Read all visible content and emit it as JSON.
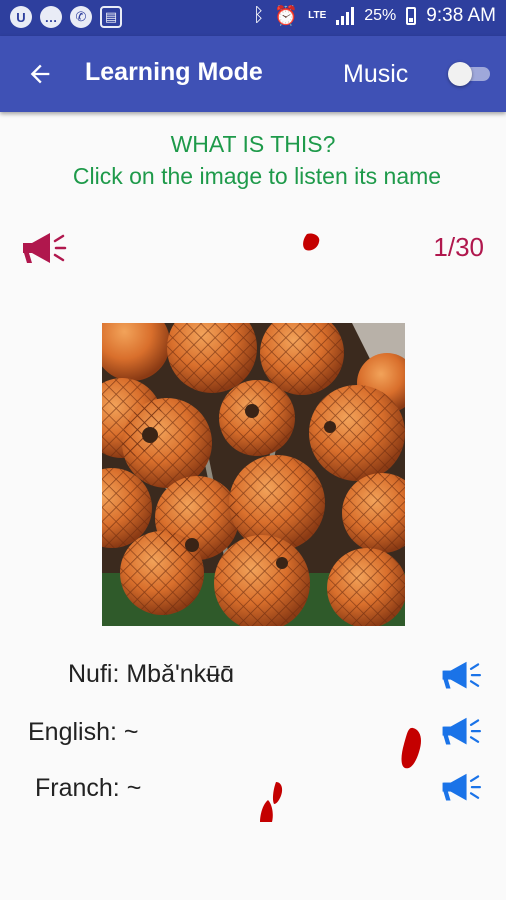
{
  "status_bar": {
    "notifications": [
      "U",
      "…",
      "✆",
      "▤"
    ],
    "network": "LTE",
    "battery": "25%",
    "time": "9:38 AM"
  },
  "app_bar": {
    "title": "Learning Mode",
    "music_label": "Music",
    "music_on": false,
    "colors": {
      "primary": "#3f51b5",
      "status": "#2e3f9e"
    }
  },
  "quiz": {
    "question": "WHAT IS THIS?",
    "instruction": "Click on the image to listen its name",
    "counter": "1/30",
    "image_subject": "cluster of orange scaly palm fruits"
  },
  "names": [
    {
      "label": "Nufi: Mbǎ'nkʉ̄ɑ̄"
    },
    {
      "label": "English: ~"
    },
    {
      "label": "Franch: ~"
    }
  ],
  "icons": {
    "speaker_main": "megaphone-icon",
    "speaker_lang": "megaphone-icon",
    "colors": {
      "main": "#b0174d",
      "lang": "#1a73e8",
      "splash": "#c40000"
    }
  }
}
